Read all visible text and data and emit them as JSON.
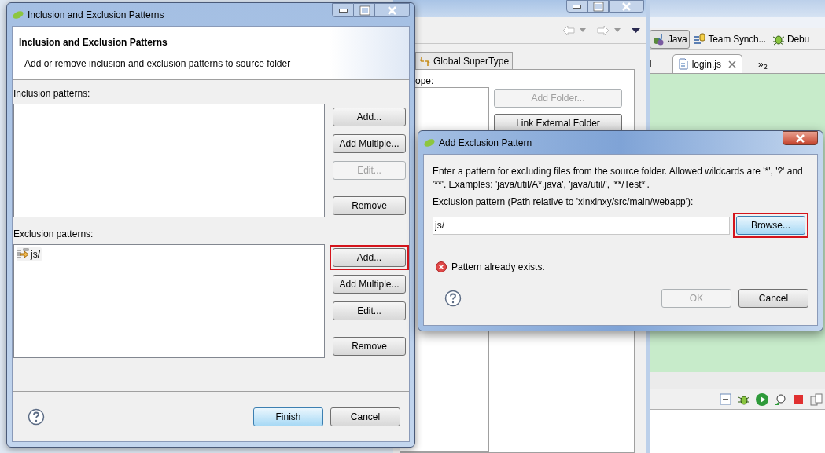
{
  "ide": {
    "perspectives": [
      {
        "label": "Java",
        "selected": true
      },
      {
        "label": "Team Synch...",
        "selected": false
      },
      {
        "label": "Debu",
        "selected": false
      }
    ],
    "editor_tabs": [
      {
        "label": "l",
        "selected": false
      },
      {
        "label": "login.js",
        "selected": true
      }
    ],
    "overflow": "»$_{2}$"
  },
  "background_dialog": {
    "tab": "Global SuperType",
    "scope_label": "ope:",
    "buttons": [
      {
        "label": "Add Folder...",
        "disabled": true
      },
      {
        "label": "Link External Folder",
        "disabled": false
      }
    ]
  },
  "main_dialog": {
    "title": "Inclusion and Exclusion Patterns",
    "heading": "Inclusion and Exclusion Patterns",
    "description": "Add or remove inclusion and exclusion patterns to source folder",
    "sections": [
      {
        "label": "Inclusion patterns:",
        "buttons": [
          {
            "label": "Add...",
            "disabled": false,
            "highlighted": false
          },
          {
            "label": "Add Multiple...",
            "disabled": false,
            "highlighted": false
          },
          {
            "label": "Edit...",
            "disabled": true,
            "highlighted": false
          },
          {
            "label": "Remove",
            "disabled": false,
            "highlighted": false
          }
        ]
      },
      {
        "label": "Exclusion patterns:",
        "items": [
          {
            "label": "js/"
          }
        ],
        "buttons": [
          {
            "label": "Add...",
            "disabled": false,
            "highlighted": true
          },
          {
            "label": "Add Multiple...",
            "disabled": false,
            "highlighted": false
          },
          {
            "label": "Edit...",
            "disabled": false,
            "highlighted": false
          },
          {
            "label": "Remove",
            "disabled": false,
            "highlighted": false
          }
        ]
      }
    ],
    "footer_buttons": [
      {
        "label": "Finish",
        "default": true
      },
      {
        "label": "Cancel",
        "default": false
      }
    ]
  },
  "add_dialog": {
    "title": "Add Exclusion Pattern",
    "message": "Enter a pattern for excluding files from the source folder. Allowed wildcards are '*', '?' and '**'. Examples: 'java/util/A*.java', 'java/util/', '**/Test*'.",
    "field_label": "Exclusion pattern (Path relative to 'xinxinxy/src/main/webapp'):",
    "field_value": "js/",
    "browse": {
      "label": "Browse...",
      "highlighted": true
    },
    "error": "Pattern already exists.",
    "buttons": [
      {
        "label": "OK",
        "disabled": true
      },
      {
        "label": "Cancel",
        "disabled": false
      }
    ]
  }
}
